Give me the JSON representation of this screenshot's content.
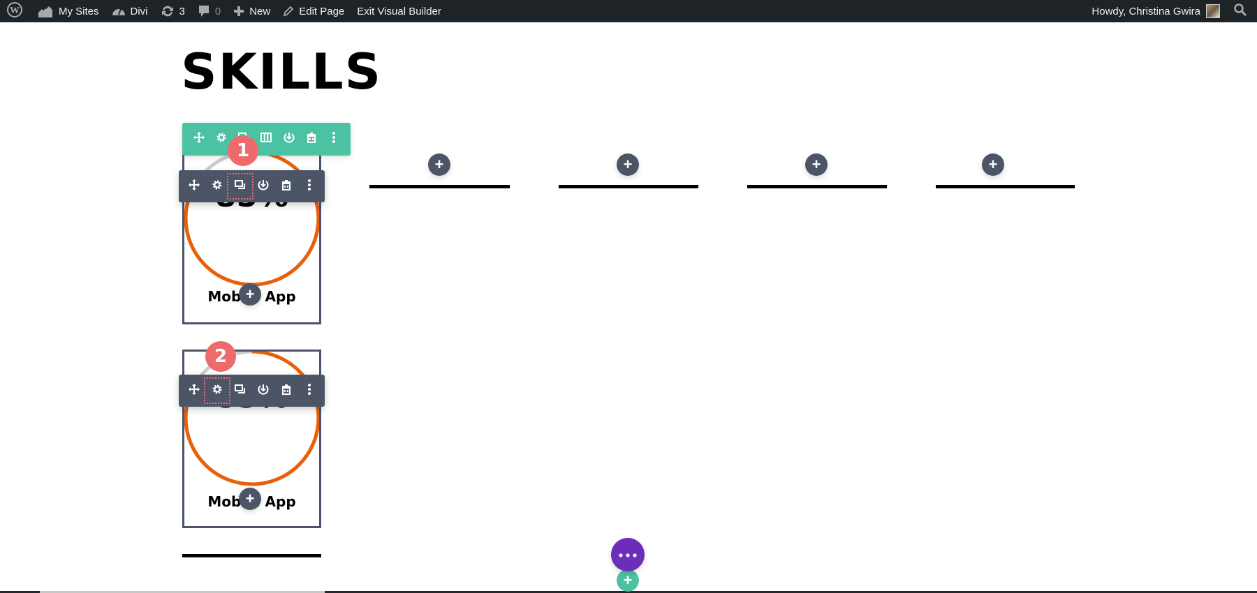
{
  "adminbar": {
    "wp_logo": "wordpress-icon",
    "items": [
      {
        "icon": "my-sites-icon",
        "label": "My Sites"
      },
      {
        "icon": "divi-dashboard-icon",
        "label": "Divi"
      },
      {
        "icon": "updates-icon",
        "label": "3"
      },
      {
        "icon": "comments-icon",
        "label": "0"
      },
      {
        "icon": "plus-icon",
        "label": "New"
      },
      {
        "icon": "pencil-icon",
        "label": "Edit Page"
      },
      {
        "icon": "",
        "label": "Exit Visual Builder"
      }
    ],
    "greeting": "Howdy, Christina Gwira",
    "search_icon": "search-icon"
  },
  "page": {
    "title": "SKILLS"
  },
  "row_toolbar": {
    "buttons": [
      "move",
      "settings",
      "duplicate",
      "columns",
      "save-to-library",
      "delete",
      "more"
    ]
  },
  "modules": [
    {
      "percent": "85%",
      "percent_value": 85,
      "label": "Mobile App",
      "badge": "1",
      "highlighted_button": "duplicate"
    },
    {
      "percent": "85%",
      "percent_value": 85,
      "label": "Mobile App",
      "badge": "2",
      "highlighted_button": "settings"
    }
  ],
  "module_toolbar": {
    "buttons": [
      "move",
      "settings",
      "duplicate",
      "save-to-library",
      "delete",
      "more"
    ]
  },
  "add_module_symbol": "+",
  "colors": {
    "ring_fill": "#e8600a",
    "ring_track": "#cccccc",
    "row_toolbar": "#4dc2a3",
    "module_toolbar": "#4b5566",
    "badge": "#ef6b6b",
    "page_settings_button": "#6c2eb9"
  }
}
